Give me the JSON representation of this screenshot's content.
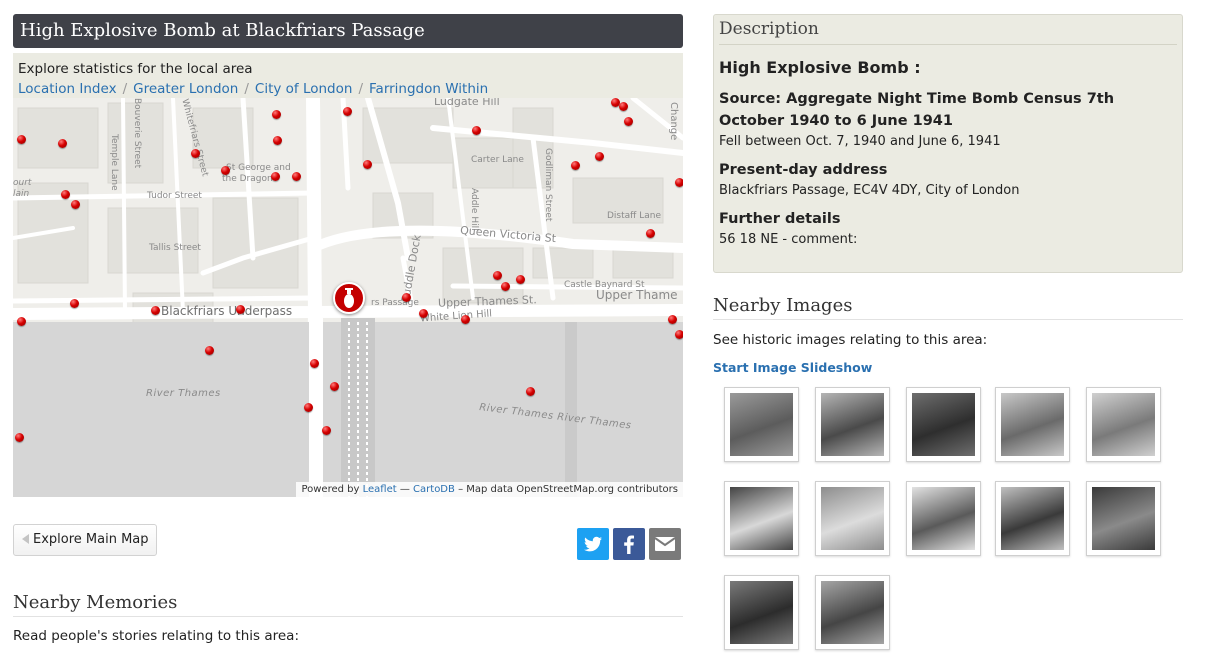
{
  "page": {
    "title": "High Explosive Bomb at Blackfriars Passage",
    "explore_text": "Explore statistics for the local area",
    "breadcrumbs": [
      "Location Index",
      "Greater London",
      "City of London",
      "Farringdon Within"
    ],
    "breadcrumb_separator": "/"
  },
  "map": {
    "labels": {
      "ludgate_hill": "Ludgate Hill",
      "carter_lane": "Carter Lane",
      "addle_hill": "Addle Hill",
      "godliman_street": "Godliman Street",
      "distaff_lane": "Distaff Lane",
      "queen_victoria_st": "Queen Victoria St",
      "st_george": "St George and",
      "the_dragon": "the Dragon",
      "tudor_street": "Tudor Street",
      "tallis_street": "Tallis Street",
      "temple_lane": "Temple Lane",
      "whitefriars_street": "Whitefriars Street",
      "bouverie_street": "Bouverie Street",
      "puddle_dock": "Puddle Dock",
      "castle_baynard_st": "Castle Baynard St",
      "upper_thames_st": "Upper Thames St.",
      "upper_thames": "Upper Thame",
      "blackfriars_underpass": "Blackfriars Underpass",
      "white_lion_hill": "White Lion Hill",
      "blackfriars_passage": "rs Passage",
      "river_thames_left": "River Thames",
      "river_thames_right": "River Thames River Thames",
      "court": "ourt",
      "lain": "lain",
      "change": "Change"
    },
    "attribution": {
      "prefix": "Powered by",
      "leaflet": "Leaflet",
      "dash": "—",
      "cartodb": "CartoDB",
      "rest": "– Map data OpenStreetMap.org contributors"
    },
    "marker_count": 40
  },
  "buttons": {
    "explore_main_map": "Explore Main Map"
  },
  "share": {
    "twitter": "twitter-icon",
    "facebook": "facebook-icon",
    "email": "email-icon"
  },
  "memories": {
    "heading": "Nearby Memories",
    "text": "Read people's stories relating to this area:"
  },
  "description": {
    "heading": "Description",
    "bomb_type": "High Explosive Bomb :",
    "source_label": "Source: Aggregate Night Time Bomb Census 7th October 1940 to 6 June 1941",
    "source_text": "Fell between Oct. 7, 1940 and June 6, 1941",
    "address_label": "Present-day address",
    "address_text": "Blackfriars Passage, EC4V 4DY, City of London",
    "details_label": "Further details",
    "details_text": "56 18 NE - comment:"
  },
  "images": {
    "heading": "Nearby Images",
    "text": "See historic images relating to this area:",
    "slideshow": "Start Image Slideshow",
    "count": 12
  },
  "colors": {
    "title_bar": "#3f4148",
    "panel": "#ebebe2",
    "link": "#2a70b0",
    "marker": "#d60000",
    "twitter": "#1da1f2",
    "facebook": "#3b5998",
    "email": "#7a7a7a"
  }
}
